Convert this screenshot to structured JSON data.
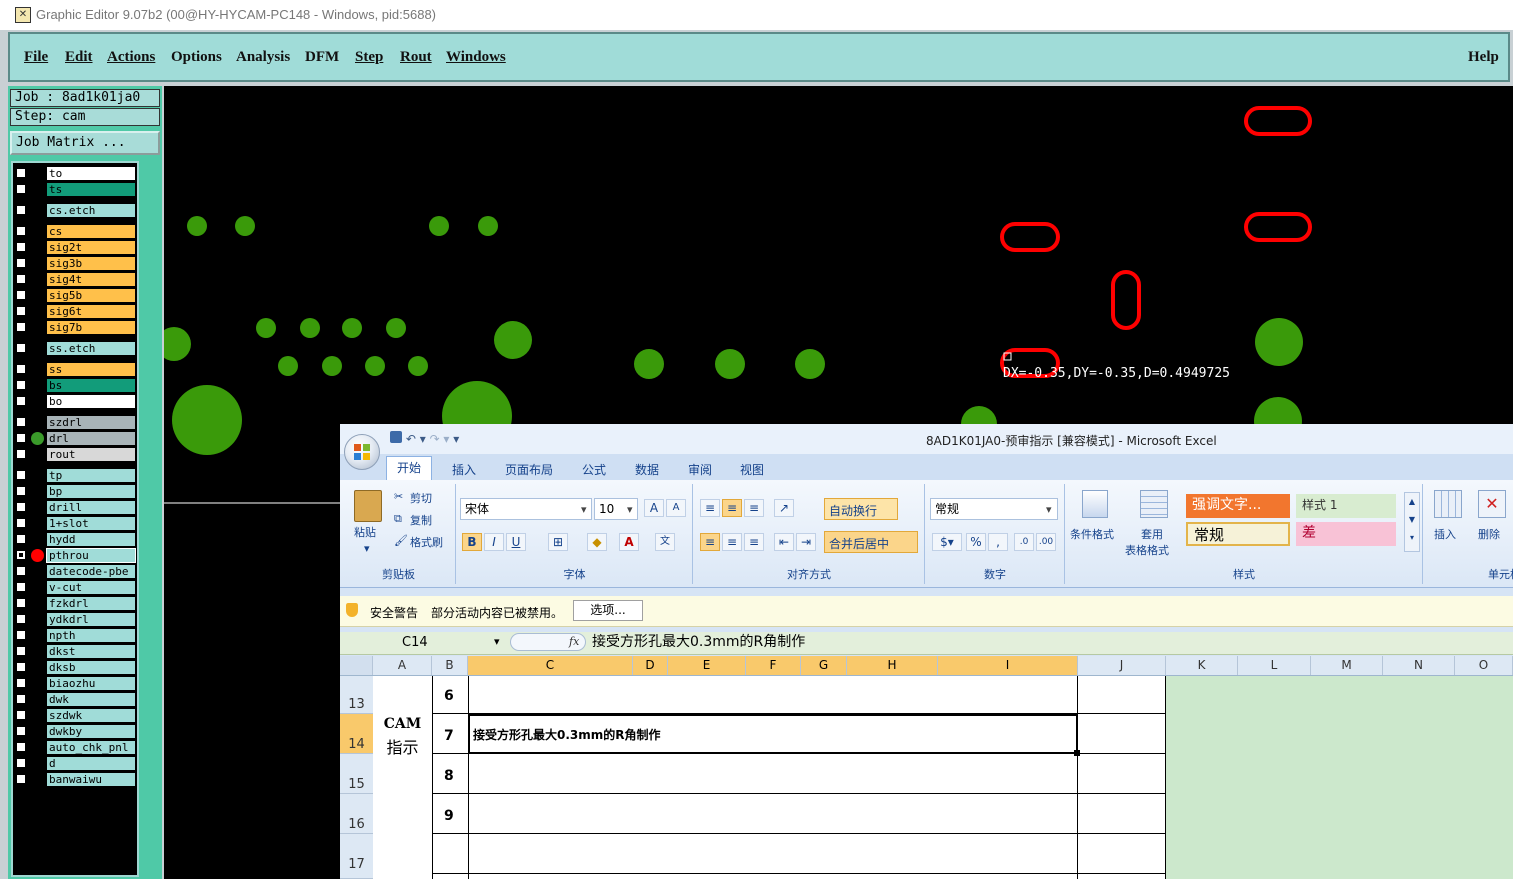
{
  "app": {
    "title": "Graphic Editor 9.07b2 (00@HY-HYCAM-PC148 - Windows, pid:5688)",
    "menu": [
      "File",
      "Edit",
      "Actions",
      "Options",
      "Analysis",
      "DFM",
      "Step",
      "Rout",
      "Windows"
    ],
    "help": "Help"
  },
  "job": {
    "job_line": "Job : 8ad1k01ja0",
    "step_line": "Step: cam",
    "matrix_button": "Job Matrix ..."
  },
  "layers": [
    {
      "name": "to",
      "bg": "#ffffff",
      "group": 0
    },
    {
      "name": "ts",
      "bg": "#129c7a",
      "group": 0
    },
    {
      "name": "cs.etch",
      "bg": "#a0dcd8",
      "group": 1
    },
    {
      "name": "cs",
      "bg": "#ffc04a",
      "group": 2
    },
    {
      "name": "sig2t",
      "bg": "#ffc04a",
      "group": 2
    },
    {
      "name": "sig3b",
      "bg": "#ffc04a",
      "group": 2
    },
    {
      "name": "sig4t",
      "bg": "#ffc04a",
      "group": 2
    },
    {
      "name": "sig5b",
      "bg": "#ffc04a",
      "group": 2
    },
    {
      "name": "sig6t",
      "bg": "#ffc04a",
      "group": 2
    },
    {
      "name": "sig7b",
      "bg": "#ffc04a",
      "group": 2
    },
    {
      "name": "ss.etch",
      "bg": "#a0dcd8",
      "group": 3
    },
    {
      "name": "ss",
      "bg": "#ffc04a",
      "group": 4
    },
    {
      "name": "bs",
      "bg": "#129c7a",
      "group": 4
    },
    {
      "name": "bo",
      "bg": "#ffffff",
      "group": 4
    },
    {
      "name": "szdrl",
      "bg": "#a8b4b8",
      "group": 5
    },
    {
      "name": "drl",
      "bg": "#a8b4b8",
      "group": 5,
      "dot": "#3a9a2a"
    },
    {
      "name": "rout",
      "bg": "#d8d8d8",
      "group": 5
    },
    {
      "name": "tp",
      "bg": "#a0dcd8",
      "group": 6
    },
    {
      "name": "bp",
      "bg": "#a0dcd8",
      "group": 6
    },
    {
      "name": "drill",
      "bg": "#a0dcd8",
      "group": 6
    },
    {
      "name": "1+slot",
      "bg": "#a0dcd8",
      "group": 6
    },
    {
      "name": "hydd",
      "bg": "#a0dcd8",
      "group": 6
    },
    {
      "name": "pthrou",
      "bg": "#a0dcd8",
      "group": 6,
      "dot": "#ff0000",
      "checked": true,
      "selected": true
    },
    {
      "name": "datecode-pbe",
      "bg": "#a0dcd8",
      "group": 6
    },
    {
      "name": "v-cut",
      "bg": "#a0dcd8",
      "group": 6
    },
    {
      "name": "fzkdrl",
      "bg": "#a0dcd8",
      "group": 6
    },
    {
      "name": "ydkdrl",
      "bg": "#a0dcd8",
      "group": 6
    },
    {
      "name": "npth",
      "bg": "#a0dcd8",
      "group": 6
    },
    {
      "name": "dkst",
      "bg": "#a0dcd8",
      "group": 6
    },
    {
      "name": "dksb",
      "bg": "#a0dcd8",
      "group": 6
    },
    {
      "name": "biaozhu",
      "bg": "#a0dcd8",
      "group": 6
    },
    {
      "name": "dwk",
      "bg": "#a0dcd8",
      "group": 6
    },
    {
      "name": "szdwk",
      "bg": "#a0dcd8",
      "group": 6
    },
    {
      "name": "dwkby",
      "bg": "#a0dcd8",
      "group": 6
    },
    {
      "name": "auto_chk_pnl",
      "bg": "#a0dcd8",
      "group": 6
    },
    {
      "name": "d",
      "bg": "#a0dcd8",
      "group": 6
    },
    {
      "name": "banwaiwu",
      "bg": "#a0dcd8",
      "group": 6
    }
  ],
  "canvas": {
    "measure": "DX=-0.35,DY=-0.35,D=0.4949725",
    "pad_color": "#3a9a0a",
    "slot_color": "#ff0000"
  },
  "excel": {
    "title": "8AD1K01JA0-预审指示  [兼容模式] - Microsoft Excel",
    "tabs": [
      "开始",
      "插入",
      "页面布局",
      "公式",
      "数据",
      "审阅",
      "视图"
    ],
    "clipboard": {
      "paste": "粘贴",
      "cut": "剪切",
      "copy": "复制",
      "format_painter": "格式刷",
      "label": "剪贴板"
    },
    "font": {
      "name": "宋体",
      "size": "10",
      "label": "字体"
    },
    "align": {
      "wrap": "自动换行",
      "merge": "合并后居中",
      "label": "对齐方式"
    },
    "number": {
      "format": "常规",
      "percent": "%",
      "label": "数字"
    },
    "styles": {
      "cond": "条件格式",
      "table1": "套用",
      "table2": "表格格式",
      "accent": "强调文字...",
      "style1": "样式 1",
      "normal": "常规",
      "bad": "差",
      "label": "样式"
    },
    "cells": {
      "insert": "插入",
      "delete": "删除",
      "label": "单元格"
    },
    "security": {
      "title": "安全警告",
      "msg": "部分活动内容已被禁用。",
      "options": "选项..."
    },
    "namebox": "C14",
    "fx": "fx",
    "formula": "接受方形孔最大0.3mm的R角制作",
    "columns": [
      "A",
      "B",
      "C",
      "D",
      "E",
      "F",
      "G",
      "H",
      "I",
      "J",
      "K",
      "L",
      "M",
      "N",
      "O"
    ],
    "rows": [
      "13",
      "14",
      "15",
      "16",
      "17"
    ],
    "numbers": [
      "6",
      "7",
      "8",
      "9"
    ],
    "label_a1": "CAM",
    "label_a2": "指示",
    "c14": "接受方形孔最大0.3mm的R角制作"
  }
}
